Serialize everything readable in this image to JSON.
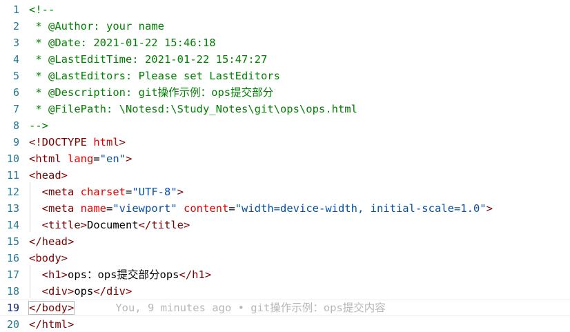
{
  "editor": {
    "lines": [
      {
        "num": "1",
        "parts": [
          {
            "t": "<!--",
            "c": "cm"
          }
        ]
      },
      {
        "num": "2",
        "parts": [
          {
            "t": " * @Author: your name",
            "c": "cm"
          }
        ]
      },
      {
        "num": "3",
        "parts": [
          {
            "t": " * @Date: 2021-01-22 15:46:18",
            "c": "cm"
          }
        ]
      },
      {
        "num": "4",
        "parts": [
          {
            "t": " * @LastEditTime: 2021-01-22 15:47:27",
            "c": "cm"
          }
        ]
      },
      {
        "num": "5",
        "parts": [
          {
            "t": " * @LastEditors: Please set LastEditors",
            "c": "cm"
          }
        ]
      },
      {
        "num": "6",
        "parts": [
          {
            "t": " * @Description: git操作示例：ops提交部分",
            "c": "cm"
          }
        ]
      },
      {
        "num": "7",
        "parts": [
          {
            "t": " * @FilePath: \\Notesd:\\Study_Notes\\git\\ops\\ops.html",
            "c": "cm"
          }
        ]
      },
      {
        "num": "8",
        "parts": [
          {
            "t": "-->",
            "c": "cm"
          }
        ]
      },
      {
        "num": "9",
        "parts": [
          {
            "t": "<!DOCTYPE ",
            "c": "tag"
          },
          {
            "t": "html",
            "c": "attr"
          },
          {
            "t": ">",
            "c": "tag"
          }
        ]
      },
      {
        "num": "10",
        "parts": [
          {
            "t": "<html ",
            "c": "tag"
          },
          {
            "t": "lang",
            "c": "attr"
          },
          {
            "t": "=",
            "c": "eq"
          },
          {
            "t": "\"en\"",
            "c": "val"
          },
          {
            "t": ">",
            "c": "tag"
          }
        ]
      },
      {
        "num": "11",
        "parts": [
          {
            "t": "<head>",
            "c": "tag"
          }
        ]
      },
      {
        "num": "12",
        "parts": [
          {
            "t": "  <meta ",
            "c": "tag"
          },
          {
            "t": "charset",
            "c": "attr"
          },
          {
            "t": "=",
            "c": "eq"
          },
          {
            "t": "\"UTF-8\"",
            "c": "val"
          },
          {
            "t": ">",
            "c": "tag"
          }
        ]
      },
      {
        "num": "13",
        "parts": [
          {
            "t": "  <meta ",
            "c": "tag"
          },
          {
            "t": "name",
            "c": "attr"
          },
          {
            "t": "=",
            "c": "eq"
          },
          {
            "t": "\"viewport\"",
            "c": "val"
          },
          {
            "t": " ",
            "c": "txt"
          },
          {
            "t": "content",
            "c": "attr"
          },
          {
            "t": "=",
            "c": "eq"
          },
          {
            "t": "\"width=device-width, initial-scale=1.0\"",
            "c": "val"
          },
          {
            "t": ">",
            "c": "tag"
          }
        ]
      },
      {
        "num": "14",
        "parts": [
          {
            "t": "  <title>",
            "c": "tag"
          },
          {
            "t": "Document",
            "c": "txt"
          },
          {
            "t": "</title>",
            "c": "tag"
          }
        ]
      },
      {
        "num": "15",
        "parts": [
          {
            "t": "</head>",
            "c": "tag"
          }
        ]
      },
      {
        "num": "16",
        "parts": [
          {
            "t": "<body>",
            "c": "tag"
          }
        ]
      },
      {
        "num": "17",
        "parts": [
          {
            "t": "  <h1>",
            "c": "tag"
          },
          {
            "t": "ops：ops提交部分ops",
            "c": "txt"
          },
          {
            "t": "</h1>",
            "c": "tag"
          }
        ]
      },
      {
        "num": "18",
        "parts": [
          {
            "t": "  <div>",
            "c": "tag"
          },
          {
            "t": "ops",
            "c": "txt"
          },
          {
            "t": "</div>",
            "c": "tag"
          }
        ]
      },
      {
        "num": "19",
        "active": true,
        "parts": [
          {
            "t": "</body>",
            "c": "tag"
          }
        ],
        "blame": "You, 9 minutes ago • git操作示例：ops提交内容"
      },
      {
        "num": "20",
        "parts": [
          {
            "t": "</html>",
            "c": "tag"
          }
        ]
      }
    ]
  }
}
